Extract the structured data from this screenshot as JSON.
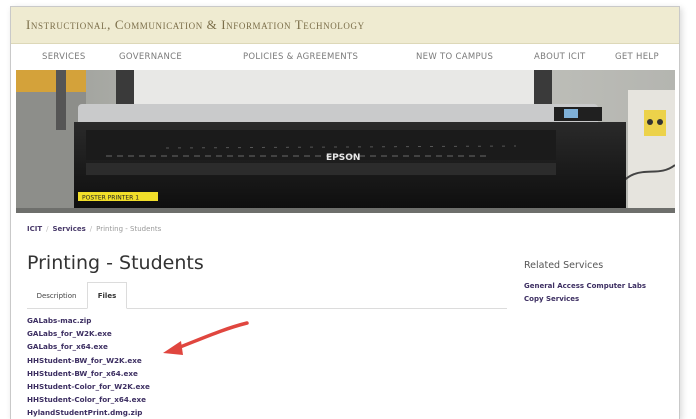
{
  "banner": {
    "title": "Instructional, Communication & Information Technology"
  },
  "nav": {
    "items": [
      {
        "label": "SERVICES"
      },
      {
        "label": "GOVERNANCE"
      },
      {
        "label": "POLICIES & AGREEMENTS"
      },
      {
        "label": "NEW TO CAMPUS"
      },
      {
        "label": "ABOUT ICIT"
      },
      {
        "label": "GET HELP"
      }
    ]
  },
  "hero": {
    "printer_brand": "EPSON",
    "sticker_label": "POSTER PRINTER 1"
  },
  "breadcrumb": {
    "items": [
      "ICIT",
      "Services",
      "Printing - Students"
    ]
  },
  "page": {
    "title": "Printing - Students"
  },
  "tabs": {
    "items": [
      {
        "label": "Description"
      },
      {
        "label": "Files"
      }
    ],
    "active": "Files"
  },
  "files": [
    "GALabs-mac.zip",
    "GALabs_for_W2K.exe",
    "GALabs_for_x64.exe",
    "HHStudent-BW_for_W2K.exe",
    "HHStudent-BW_for_x64.exe",
    "HHStudent-Color_for_W2K.exe",
    "HHStudent-Color_for_x64.exe",
    "HylandStudentPrint.dmg.zip"
  ],
  "related": {
    "title": "Related Services",
    "links": [
      "General Access Computer Labs",
      "Copy Services"
    ]
  },
  "colors": {
    "banner_bg": "#efebd1",
    "banner_text": "#7b6e49",
    "link": "#3d2f62",
    "arrow": "#e0463f"
  }
}
